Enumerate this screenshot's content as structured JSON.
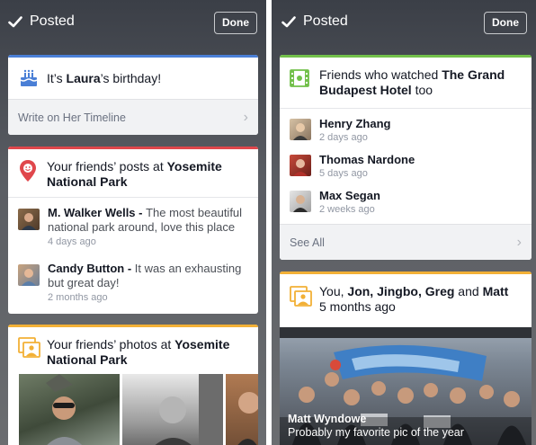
{
  "left": {
    "posted_label": "Posted",
    "done_label": "Done",
    "birthday": {
      "prefix": "It’s ",
      "name": "Laura",
      "suffix": "’s birthday!",
      "action": "Write on Her Timeline",
      "accent_color": "#4a7fd6"
    },
    "posts": {
      "title_prefix": "Your friends’ posts at ",
      "title_place_line1": "Yosemite",
      "title_place_line2": "National Park",
      "accent_color": "#e0474c",
      "items": [
        {
          "name": "M. Walker Wells",
          "sep": " - ",
          "text": "The most beautiful national park around, love this place",
          "time": "4 days ago"
        },
        {
          "name": "Candy Button",
          "sep": " - ",
          "text": "It was an exhausting but great day!",
          "time": "2 months ago"
        }
      ]
    },
    "photos": {
      "title_prefix": "Your friends’ photos at ",
      "title_place_line1": "Yosemite",
      "title_place_line2": "National Park",
      "accent_color": "#f2b036"
    }
  },
  "right": {
    "posted_label": "Posted",
    "done_label": "Done",
    "watched": {
      "title_prefix": "Friends who watched ",
      "title_movie_line1": "The Grand",
      "title_movie_line2": "Budapest Hotel",
      "title_suffix": " too",
      "accent_color": "#72c04a",
      "items": [
        {
          "name": "Henry Zhang",
          "time": "2 days ago"
        },
        {
          "name": "Thomas Nardone",
          "time": "5 days ago"
        },
        {
          "name": "Max Segan",
          "time": "2 weeks ago"
        }
      ],
      "see_all": "See All"
    },
    "group_photo": {
      "title_you": "You, ",
      "title_names": "Jon, Jingbo, Greg",
      "title_and": " and ",
      "title_last": "Matt",
      "time": "5 months ago",
      "accent_color": "#f2b036",
      "caption_name": "Matt Wyndowe",
      "caption_text": "Probably my favorite pic of the year"
    }
  }
}
